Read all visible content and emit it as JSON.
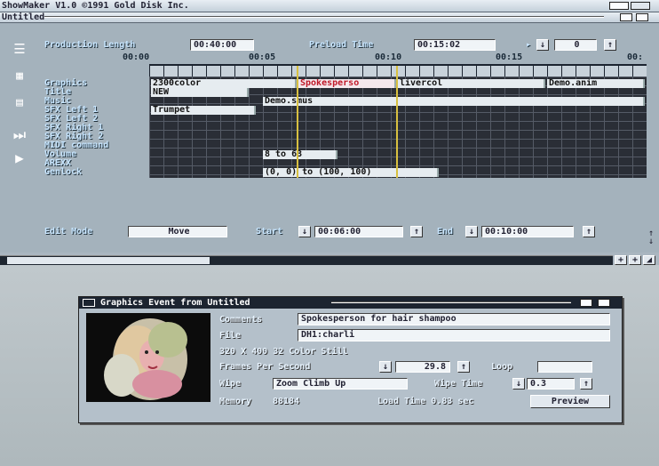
{
  "screen": {
    "title": "ShowMaker V1.0  ©1991 Gold Disk Inc.",
    "window_title": "Untitled"
  },
  "production": {
    "length_label": "Production Length",
    "length_value": "00:40:00",
    "preload_label": "Preload Time",
    "preload_value": "00:15:02",
    "stepper_value": "0"
  },
  "ruler": {
    "ticks": [
      "00:00",
      "00:05",
      "00:10",
      "00:15",
      "00:"
    ]
  },
  "tracks": [
    "Graphics",
    "Title",
    "Music",
    "SFX Left 1",
    "SFX Left 2",
    "SFX Right 1",
    "SFX Right 2",
    "MIDI command",
    "Volume",
    "AREXX",
    "Genlock"
  ],
  "events": {
    "graphics_1": "2300color",
    "graphics_2": "Spokesperso",
    "graphics_3": "livercol",
    "graphics_4": "Demo.anim",
    "title_1": "NEW",
    "music_1": "Demo.smus",
    "sfx_1": "Trumpet",
    "volume_1": "8 to 63",
    "genlock_1": "(0, 0) to (100, 100)"
  },
  "edit": {
    "mode_label": "Edit Mode",
    "mode_value": "Move",
    "start_label": "Start",
    "start_value": "00:06:00",
    "end_label": "End",
    "end_value": "00:10:00"
  },
  "dialog": {
    "title": "Graphics Event from Untitled",
    "comments_label": "Comments",
    "comments_value": "Spokesperson for hair shampoo",
    "file_label": "File",
    "file_value": "DH1:charli",
    "info": "320 X 400 32 Color Still",
    "fps_label": "Frames Per Second",
    "fps_value": "29.8",
    "loop_label": "Loop",
    "wipe_label": "Wipe",
    "wipe_value": "Zoom Climb Up",
    "wipe_time_label": "Wipe Time",
    "wipe_time_value": "0.3",
    "memory_label": "Memory",
    "memory_value": "88184",
    "load_time": "Load Time 0.83 sec",
    "preview_label": "Preview"
  },
  "colors": {
    "timeline_bg": "#2a2e36",
    "playhead": "#d8c040",
    "accent_red": "#c01828",
    "panel": "#aab6c0"
  }
}
